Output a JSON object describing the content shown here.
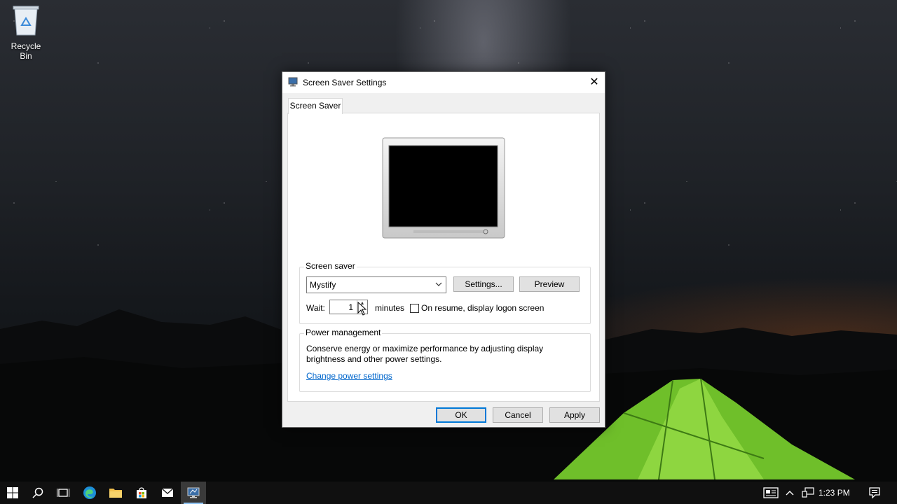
{
  "desktop": {
    "icons": [
      {
        "label": "Recycle Bin",
        "icon": "recycle-bin-icon"
      }
    ]
  },
  "dialog": {
    "title": "Screen Saver Settings",
    "close_glyph": "✕",
    "tabs": [
      {
        "label": "Screen Saver",
        "selected": true
      }
    ],
    "screen_saver_group": {
      "label": "Screen saver",
      "selected": "Mystify",
      "settings_button": "Settings...",
      "preview_button": "Preview",
      "wait_label": "Wait:",
      "wait_value": "1",
      "minutes_label": "minutes",
      "resume_checkbox_label": "On resume, display logon screen",
      "resume_checked": false
    },
    "power_group": {
      "label": "Power management",
      "description": "Conserve energy or maximize performance by adjusting display brightness and other power settings.",
      "link": "Change power settings"
    },
    "buttons": {
      "ok": "OK",
      "cancel": "Cancel",
      "apply": "Apply"
    }
  },
  "taskbar": {
    "items": [
      "start-icon",
      "search-icon",
      "task-view-icon",
      "edge-icon",
      "file-explorer-icon",
      "store-icon",
      "mail-icon",
      "screen-saver-app-icon"
    ],
    "active_item": "screen-saver-app-icon",
    "tray": [
      "news-icon",
      "chevron-up-icon",
      "network-icon"
    ],
    "clock": "1:23 PM",
    "notifications_icon": "action-center-icon"
  },
  "colors": {
    "accent": "#0078d7",
    "link": "#0066cc",
    "taskbar": "#101010"
  }
}
